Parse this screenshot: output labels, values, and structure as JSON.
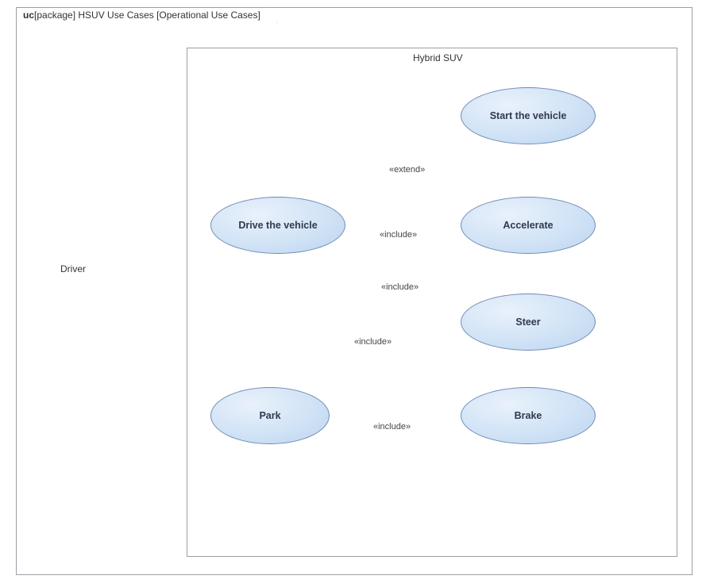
{
  "frame": {
    "kind_kw": "uc",
    "kind_text": "[package] HSUV Use Cases [Operational Use Cases]"
  },
  "subject_label": "Hybrid SUV",
  "actor_label": "Driver",
  "usecases": {
    "drive": "Drive the vehicle",
    "start": "Start the vehicle",
    "accelerate": "Accelerate",
    "steer": "Steer",
    "brake": "Brake",
    "park": "Park"
  },
  "rel_labels": {
    "extend": "«extend»",
    "include": "«include»"
  },
  "chart_data": {
    "type": "uml-use-case-diagram",
    "frame": "uc [package] HSUV Use Cases [Operational Use Cases]",
    "actors": [
      "Driver"
    ],
    "subject": "Hybrid SUV",
    "use_cases": [
      "Drive the vehicle",
      "Start the vehicle",
      "Accelerate",
      "Steer",
      "Brake",
      "Park"
    ],
    "associations": [
      {
        "actor": "Driver",
        "usecase": "Drive the vehicle"
      },
      {
        "actor": "Driver",
        "usecase": "Park"
      }
    ],
    "relationships": [
      {
        "from": "Start the vehicle",
        "to": "Drive the vehicle",
        "stereotype": "extend"
      },
      {
        "from": "Drive the vehicle",
        "to": "Accelerate",
        "stereotype": "include"
      },
      {
        "from": "Drive the vehicle",
        "to": "Steer",
        "stereotype": "include"
      },
      {
        "from": "Drive the vehicle",
        "to": "Brake",
        "stereotype": "include"
      },
      {
        "from": "Park",
        "to": "Brake",
        "stereotype": "include"
      }
    ]
  }
}
